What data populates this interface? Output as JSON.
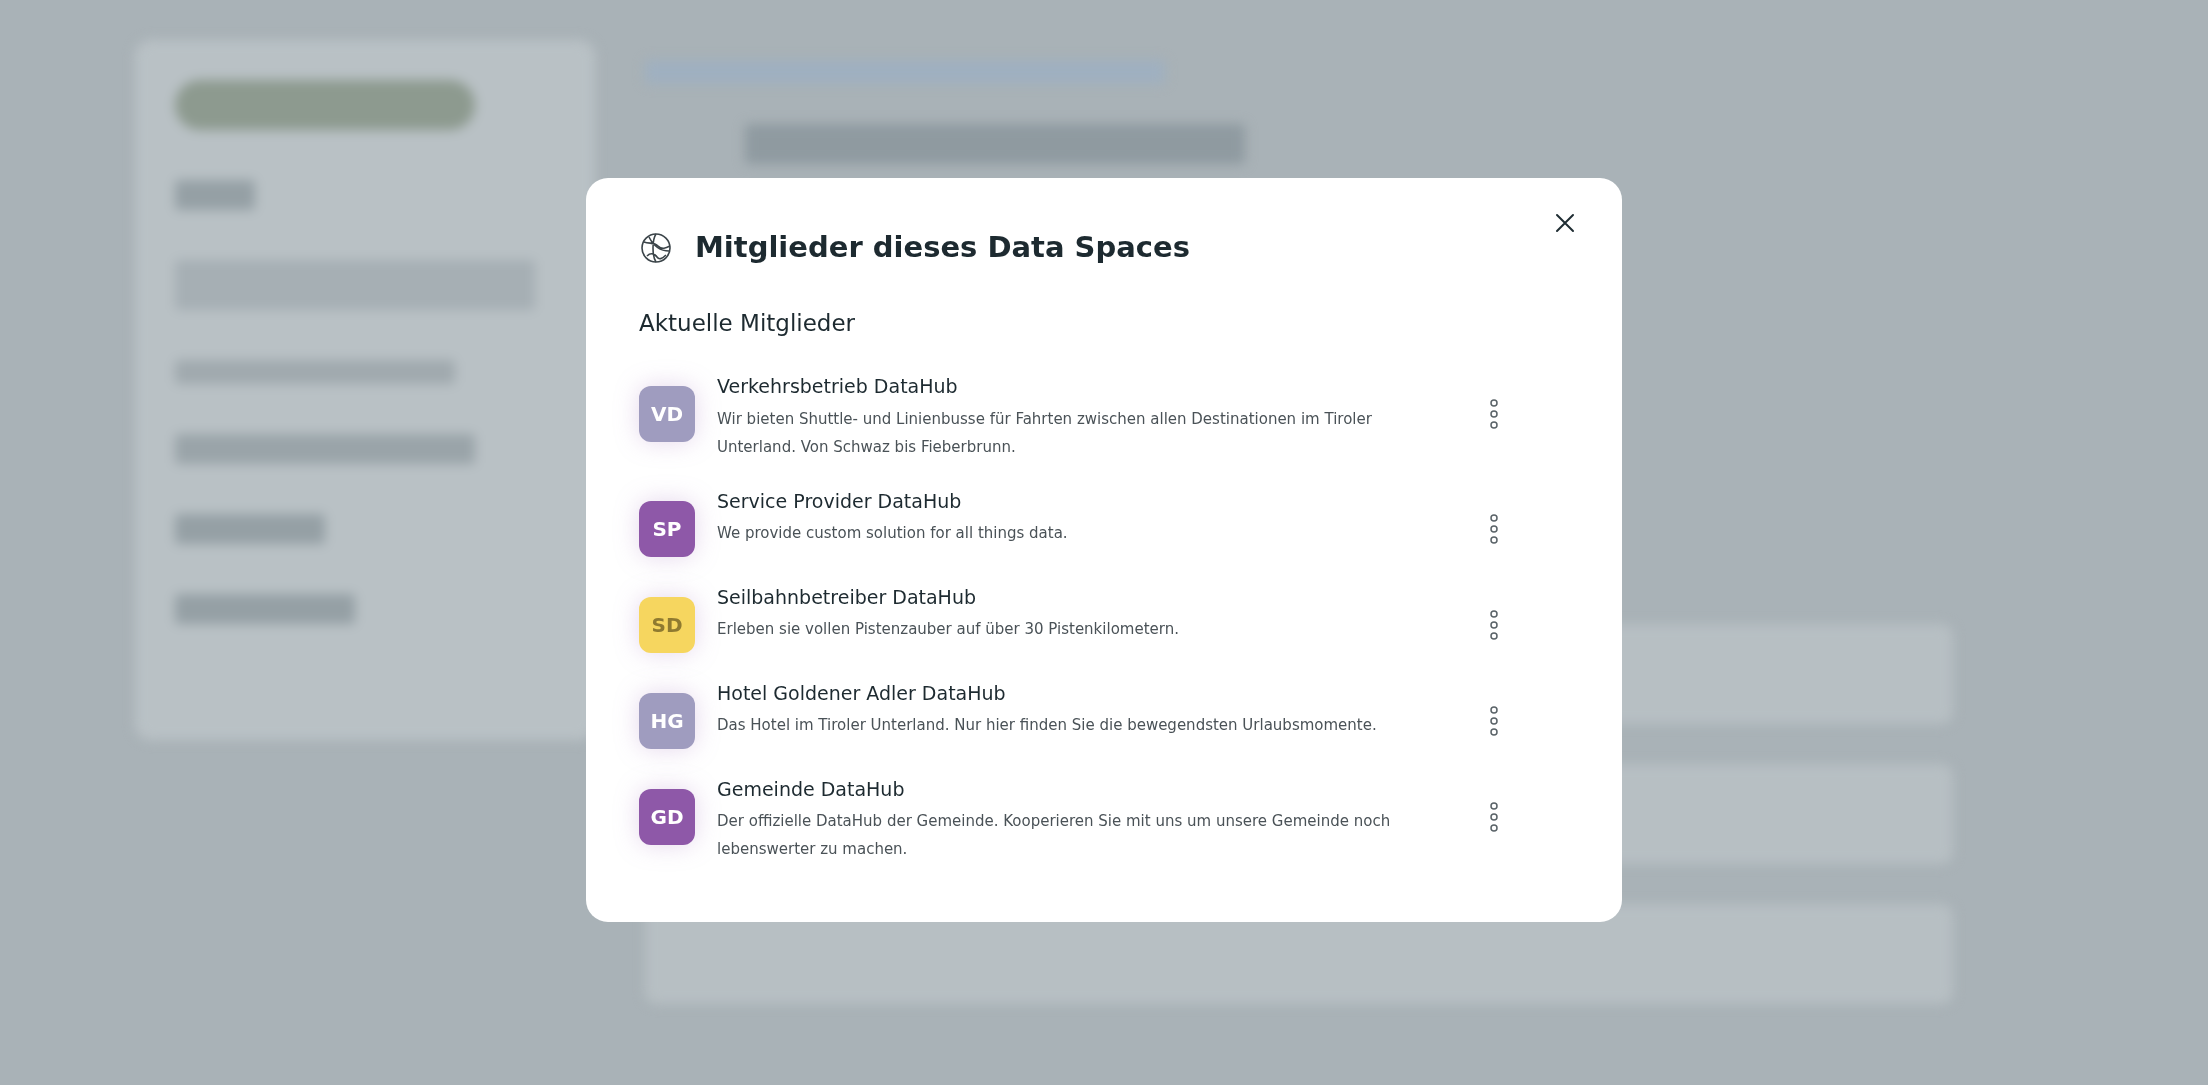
{
  "dialog": {
    "title": "Mitglieder dieses Data Spaces",
    "section_title": "Aktuelle Mitglieder",
    "members": [
      {
        "initials": "VD",
        "color": "#9f9cbf",
        "name": "Verkehrsbetrieb DataHub",
        "description": "Wir bieten Shuttle- und Linienbusse für Fahrten zwischen allen Destinationen im Tiroler Unterland. Von Schwaz bis Fieberbrunn."
      },
      {
        "initials": "SP",
        "color": "#8e58a8",
        "name": "Service Provider DataHub",
        "description": "We provide custom solution for all things data."
      },
      {
        "initials": "SD",
        "color": "#f6d65f",
        "name": "Seilbahnbetreiber DataHub",
        "description": "Erleben sie vollen Pistenzauber auf über 30 Pistenkilometern."
      },
      {
        "initials": "HG",
        "color": "#9f9cbf",
        "name": "Hotel Goldener Adler DataHub",
        "description": "Das Hotel im Tiroler Unterland. Nur hier finden Sie die bewegendsten Urlaubsmomente."
      },
      {
        "initials": "GD",
        "color": "#8e58a8",
        "name": "Gemeinde DataHub",
        "description": "Der offizielle DataHub der Gemeinde. Kooperieren Sie mit uns um unsere Gemeinde noch lebenswerter zu machen."
      }
    ]
  }
}
